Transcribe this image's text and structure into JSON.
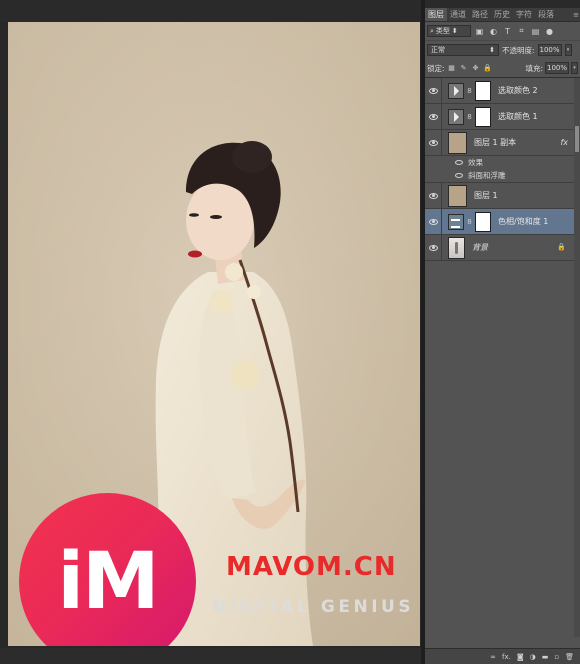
{
  "panel": {
    "tabs": [
      "图层",
      "通道",
      "路径",
      "历史",
      "字符",
      "段落"
    ],
    "filter_kind": "类型",
    "blend_mode": "正常",
    "opacity_label": "不透明度:",
    "opacity_value": "100%",
    "lock_label": "锁定:",
    "fill_label": "填充:",
    "fill_value": "100%"
  },
  "layers": [
    {
      "name": "选取颜色 2",
      "kind": "adjustment",
      "selected": false
    },
    {
      "name": "选取颜色 1",
      "kind": "adjustment",
      "selected": false
    },
    {
      "name": "图层 1 副本",
      "kind": "pixel",
      "fx": "fx",
      "selected": false
    },
    {
      "name": "图层 1",
      "kind": "pixel",
      "selected": false
    },
    {
      "name": "色相/饱和度 1",
      "kind": "hue-saturation",
      "selected": true
    },
    {
      "name": "背景",
      "kind": "background",
      "locked": true,
      "selected": false
    }
  ],
  "effects": {
    "label": "效果",
    "bevel": "斜面和浮雕"
  },
  "watermark": {
    "logo_text": "iM",
    "site": "MAVOM.CN",
    "tagline": "DIGITAL GENIUS",
    "logo_color": "#ee2a55",
    "site_color": "#e82a2a"
  },
  "footer_icons": [
    "link-icon",
    "fx-icon",
    "mask-icon",
    "adjustment-icon",
    "group-icon",
    "new-layer-icon",
    "trash-icon"
  ]
}
